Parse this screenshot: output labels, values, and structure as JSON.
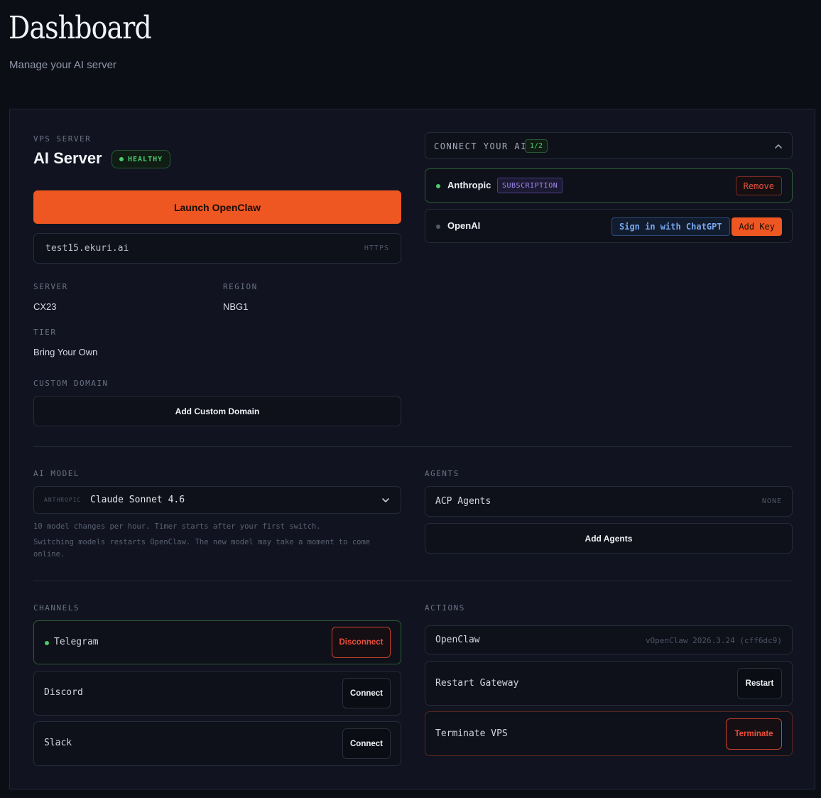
{
  "header": {
    "title": "Dashboard",
    "subtitle": "Manage your AI server"
  },
  "server": {
    "section_label": "VPS SERVER",
    "name": "AI Server",
    "status": "HEALTHY",
    "status_color": "#4ccb6b",
    "launch_label": "Launch OpenClaw",
    "launch_color": "#ee5622",
    "url": "test15.ekuri.ai",
    "url_protocol": "HTTPS",
    "server_label": "SERVER",
    "server_value": "CX23",
    "region_label": "REGION",
    "region_value": "NBG1",
    "tier_label": "TIER",
    "tier_value": "Bring Your Own",
    "custom_domain_label": "CUSTOM DOMAIN",
    "custom_domain_button": "Add Custom Domain"
  },
  "connect_ai": {
    "title": "CONNECT YOUR AI",
    "count": "1/2",
    "providers": [
      {
        "name": "Anthropic",
        "badge": "SUBSCRIPTION",
        "connected": true,
        "action": "Remove"
      },
      {
        "name": "OpenAI",
        "connected": false,
        "action_secondary": "Sign in with ChatGPT",
        "action": "Add Key"
      }
    ]
  },
  "model": {
    "section_label": "AI MODEL",
    "provider": "ANTHROPIC",
    "selected": "Claude Sonnet 4.6",
    "hint_1": "10 model changes per hour. Timer starts after your first switch.",
    "hint_2": "Switching models restarts OpenClaw. The new model may take a moment to come online."
  },
  "agents": {
    "section_label": "AGENTS",
    "row_label": "ACP Agents",
    "row_meta": "NONE",
    "add_button": "Add Agents"
  },
  "channels": {
    "section_label": "CHANNELS",
    "items": [
      {
        "name": "Telegram",
        "connected": true,
        "action": "Disconnect"
      },
      {
        "name": "Discord",
        "connected": false,
        "action": "Connect"
      },
      {
        "name": "Slack",
        "connected": false,
        "action": "Connect"
      }
    ]
  },
  "actions": {
    "section_label": "ACTIONS",
    "openclaw_label": "OpenClaw",
    "openclaw_version": "vOpenClaw 2026.3.24 (cff6dc9)",
    "restart_label": "Restart Gateway",
    "restart_button": "Restart",
    "terminate_label": "Terminate VPS",
    "terminate_button": "Terminate",
    "danger_color": "#ec4f3c"
  }
}
